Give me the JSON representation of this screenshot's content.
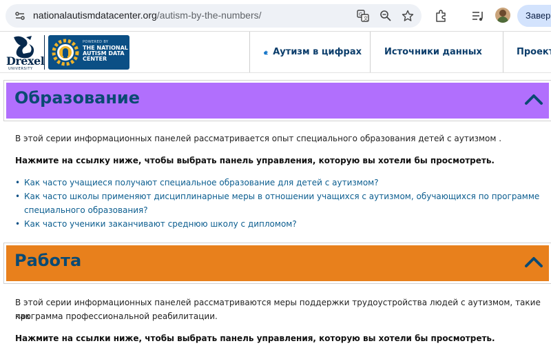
{
  "browser": {
    "url_host": "nationalautismdatacenter.org",
    "url_path": "/autism-by-the-numbers/",
    "finish_button": "Заверш"
  },
  "header": {
    "drexel_name": "Drexel",
    "drexel_sub": "UNIVERSITY",
    "nadc_powered": "POWERED BY",
    "nadc_name": "THE NATIONAL AUTISM DATA CENTER",
    "nav": [
      {
        "label": "Аутизм в цифрах",
        "icon": "puzzle-icon"
      },
      {
        "label": "Источники данных"
      },
      {
        "label": "Проекты"
      }
    ]
  },
  "sections": {
    "education": {
      "title": "Образование",
      "color": "#b16ffd",
      "intro": "В этой серии информационных панелей рассматривается опыт специального образования детей с аутизмом .",
      "instruction": "Нажмите на ссылку ниже, чтобы выбрать панель управления, которую вы хотели бы просмотреть.",
      "links": [
        "Как часто учащиеся получают специальное образование для детей с аутизмом?",
        "Как часто школы применяют дисциплинарные меры в отношении учащихся с аутизмом, обучающихся по программе",
        "специального образования?",
        "Как часто ученики заканчивают среднюю школу с дипломом?"
      ]
    },
    "work": {
      "title": "Работа",
      "color": "#e8801c",
      "intro_line1": "В этой серии информационных панелей рассматриваются меры поддержки трудоустройства людей с аутизмом, такие как",
      "intro_line2": "программа профессиональной реабилитации.",
      "instruction": "Нажмите на ссылки ниже, чтобы выбрать панель управления, которую вы хотели бы просмотреть."
    }
  }
}
